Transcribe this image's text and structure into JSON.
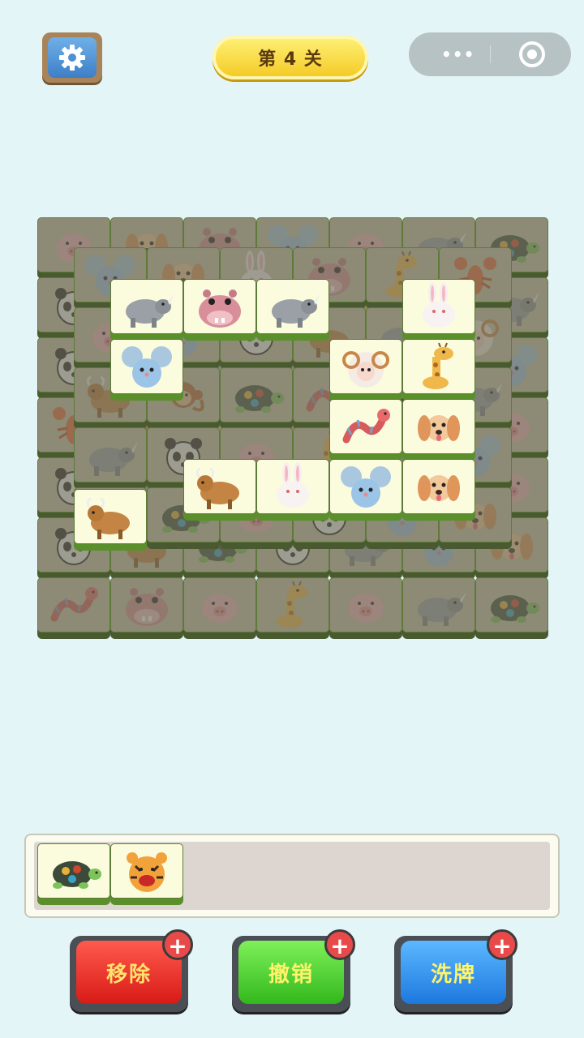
{
  "header": {
    "level_label": "第 4 关",
    "capsule_more": "•••"
  },
  "colors": {
    "background": "#e4f5f8",
    "tile_face": "#fbfbde",
    "tile_base": "#5a8f2b",
    "remove_button": "#e8231f",
    "undo_button": "#4ad42a",
    "shuffle_button": "#2d8fe8"
  },
  "board": {
    "bottom_layer": [
      [
        "pig",
        "dog",
        "hippo",
        "mouse",
        "pig",
        "rhino",
        "turtle"
      ],
      [
        "panda",
        "pig",
        "mouse",
        "rhino",
        "giraffe",
        "mouse",
        "rhino"
      ],
      [
        "panda",
        "pig",
        "mouse",
        "hippo",
        "giraffe",
        "rhino",
        "mouse"
      ],
      [
        "lobster",
        "ox",
        "monkey",
        "hippo",
        "dog",
        "sheep",
        "pig"
      ],
      [
        "panda",
        "rhino",
        "panda",
        "pig",
        "rhino",
        "mouse",
        "pig"
      ],
      [
        "panda",
        "ox",
        "turtle",
        "panda",
        "rhino",
        "mouse",
        "dog"
      ],
      [
        "dragon",
        "hippo",
        "pig",
        "giraffe",
        "pig",
        "rhino",
        "turtle"
      ]
    ],
    "middle_layer": [
      [
        "mouse",
        "dog",
        "rabbit",
        "hippo",
        "giraffe",
        "lobster"
      ],
      [
        "pig",
        "mouse",
        "panda",
        "ox",
        "rhino",
        "sheep"
      ],
      [
        "ox",
        "monkey",
        "turtle",
        "dragon",
        "dog",
        "rhino"
      ],
      [
        "rhino",
        "panda",
        "pig",
        "giraffe",
        "rhino",
        "mouse"
      ],
      [
        "mouse",
        "turtle",
        "pig",
        "panda",
        "mouse",
        "dog"
      ]
    ],
    "top_tiles": [
      {
        "animal": "rhino",
        "col": 0,
        "row": 0
      },
      {
        "animal": "hippo",
        "col": 1,
        "row": 0
      },
      {
        "animal": "rhino",
        "col": 2,
        "row": 0
      },
      {
        "animal": "rabbit",
        "col": 4,
        "row": 0
      },
      {
        "animal": "mouse",
        "col": 0,
        "row": 1
      },
      {
        "animal": "sheep",
        "col": 3,
        "row": 1
      },
      {
        "animal": "giraffe",
        "col": 4,
        "row": 1
      },
      {
        "animal": "dragon",
        "col": 3,
        "row": 2
      },
      {
        "animal": "dog",
        "col": 4,
        "row": 2
      },
      {
        "animal": "ox",
        "col": 1,
        "row": 3
      },
      {
        "animal": "rabbit",
        "col": 2,
        "row": 3
      },
      {
        "animal": "mouse",
        "col": 3,
        "row": 3
      },
      {
        "animal": "dog",
        "col": 4,
        "row": 3
      },
      {
        "animal": "ox",
        "col": -0.5,
        "row": 3.5
      }
    ]
  },
  "tray": {
    "slots_total": 7,
    "tiles": [
      "turtle",
      "tiger"
    ]
  },
  "buttons": [
    {
      "id": "remove",
      "label": "移除",
      "plus": "+"
    },
    {
      "id": "undo",
      "label": "撤销",
      "plus": "+"
    },
    {
      "id": "shuffle",
      "label": "洗牌",
      "plus": "+"
    }
  ]
}
